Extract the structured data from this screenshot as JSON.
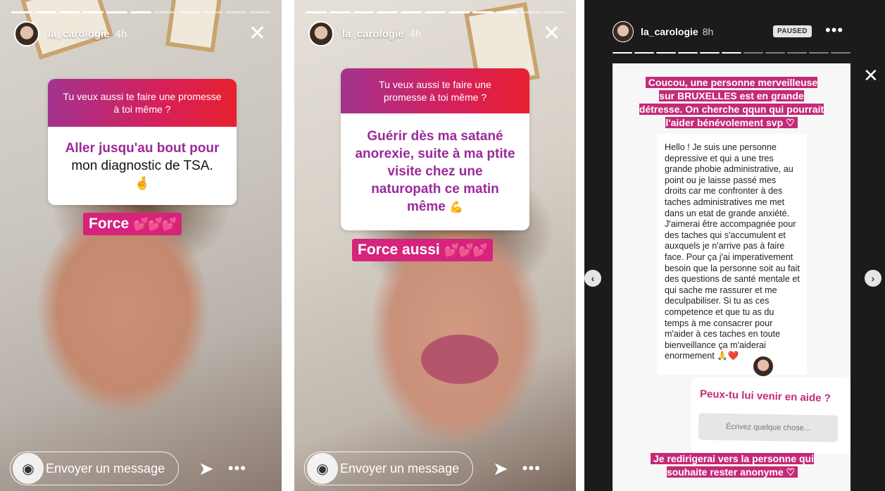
{
  "panels": [
    {
      "username": "la_carologie",
      "time": "4h",
      "question": "Tu veux aussi te faire une promesse à toi même ?",
      "answer_part1": "Aller jusqu'au bout pour",
      "answer_part2": "mon diagnostic de TSA.",
      "answer_emoji": "🤞",
      "sticker": "Force",
      "sticker_hearts": "💕💕💕",
      "message_placeholder": "Envoyer un message"
    },
    {
      "username": "la_carologie",
      "time": "4h",
      "question": "Tu veux aussi te faire une promesse à toi même ?",
      "answer": "Guérir dès ma satané anorexie, suite à ma ptite visite chez une naturopath ce matin même",
      "answer_emoji": "💪",
      "sticker": "Force aussi",
      "sticker_hearts": "💕💕💕",
      "message_placeholder": "Envoyer un message"
    },
    {
      "username": "la_carologie",
      "time": "8h",
      "status": "PAUSED",
      "top_text": "Coucou, une personne merveilleuse sur BRUXELLES est en grande détresse. On cherche qqun qui pourrait l'aider bénévolement svp ♡",
      "dm_text": "Hello ! Je suis une personne depressive et qui a une tres grande phobie administrative, au point ou je laisse passé mes droits car me confronter à des taches administratives me met dans un etat de grande anxiété. J'aimerai être accompagnée pour des taches qui s'accumulent et auxquels je n'arrive pas à faire face. Pour ça j'ai imperativement besoin que la personne soit au fait des questions de santé mentale et qui sache me rassurer et me deculpabiliser. Si tu as ces competence et que tu as du temps à me consacrer pour m'aider à ces taches en toute bienveillance ça m'aiderai enormement 🙏❤️",
      "question_title": "Peux-tu lui venir en aide ?",
      "question_placeholder": "Écrivez quelque chose...",
      "bottom_text": "Je redirigerai vers la personne qui souhaite rester anonyme ♡"
    }
  ],
  "icons": {
    "close": "✕",
    "camera": "◉",
    "send": "➤",
    "more": "•••",
    "prev": "‹",
    "next": "›"
  },
  "colors": {
    "sticker_pink": "#d6237b",
    "question_gradient_start": "#a3338f",
    "question_gradient_end": "#e8202f",
    "answer_purple": "#9b2a9a"
  }
}
